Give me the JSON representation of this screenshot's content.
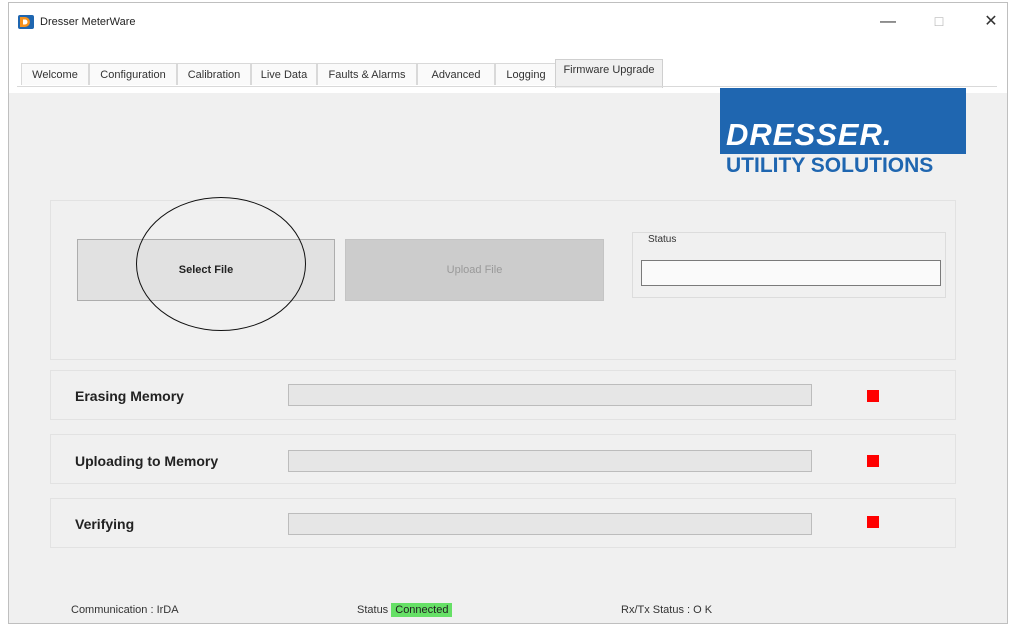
{
  "window": {
    "title": "Dresser MeterWare",
    "minimize_glyph": "—",
    "maximize_glyph": "☐",
    "close_glyph": "✕"
  },
  "tabs": [
    {
      "label": "Welcome"
    },
    {
      "label": "Configuration"
    },
    {
      "label": "Calibration"
    },
    {
      "label": "Live Data"
    },
    {
      "label": "Faults & Alarms"
    },
    {
      "label": "Advanced"
    },
    {
      "label": "Logging"
    },
    {
      "label": "Firmware Upgrade",
      "active": true
    }
  ],
  "logo": {
    "brand": "DRESSER.",
    "subtitle": "UTILITY SOLUTIONS",
    "brand_color": "#1f66b0"
  },
  "firmware": {
    "select_file_label": "Select File",
    "upload_file_label": "Upload File",
    "status_label": "Status",
    "status_value": ""
  },
  "progress": [
    {
      "label": "Erasing Memory",
      "percent": 0,
      "indicator_color": "#ff0000"
    },
    {
      "label": "Uploading to Memory",
      "percent": 0,
      "indicator_color": "#ff0000"
    },
    {
      "label": "Verifying",
      "percent": 0,
      "indicator_color": "#ff0000"
    }
  ],
  "footer": {
    "communication": "Communication : IrDA",
    "status_label": "Status",
    "status_value": "Connected",
    "status_color": "#66e066",
    "rxtx": "Rx/Tx Status : O K"
  },
  "icons": {
    "app": "dresser-app-icon"
  }
}
